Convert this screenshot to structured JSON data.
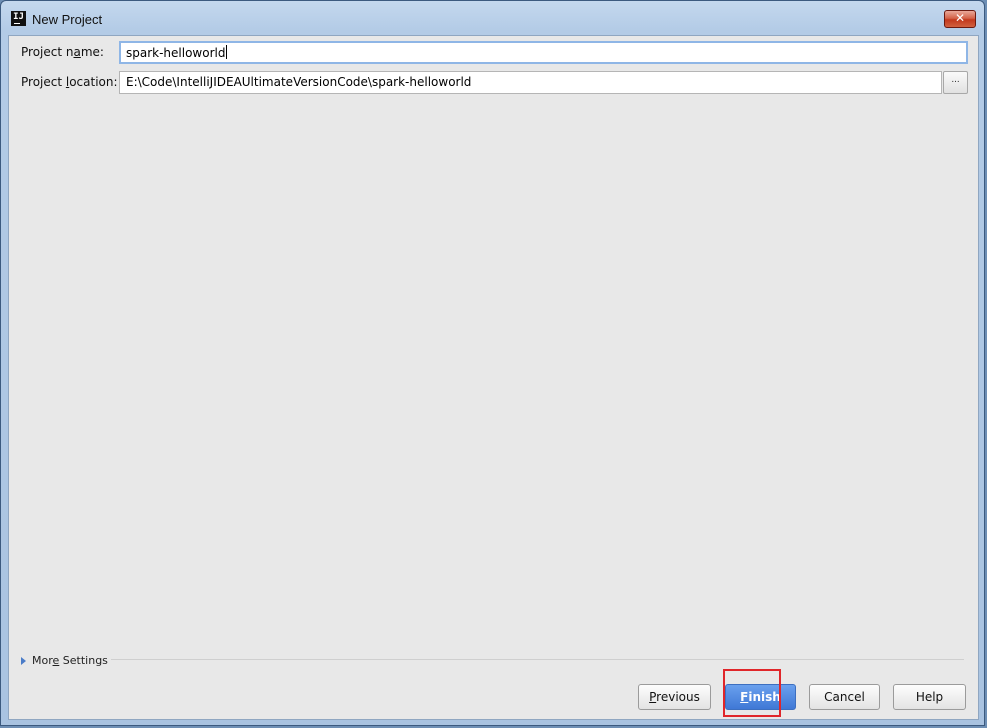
{
  "window": {
    "title": "New Project",
    "close_symbol": "✕",
    "app_icon_text": "IJ"
  },
  "form": {
    "project_name": {
      "label_pre": "Project n",
      "label_ul": "a",
      "label_post": "me:",
      "value": "spark-helloworld"
    },
    "project_location": {
      "label_pre": "Project ",
      "label_ul": "l",
      "label_post": "ocation:",
      "value": "E:\\Code\\IntelliJIDEAUltimateVersionCode\\spark-helloworld",
      "browse_label": "..."
    }
  },
  "more_settings": {
    "label_pre": "Mor",
    "label_ul": "e",
    "label_post": " Settings"
  },
  "buttons": {
    "previous": {
      "label_ul": "P",
      "label_post": "revious"
    },
    "finish": {
      "label_ul": "F",
      "label_post": "inish"
    },
    "cancel": {
      "label": "Cancel"
    },
    "help": {
      "label": "Help"
    }
  },
  "colors": {
    "accent": "#3f78d6",
    "highlight": "#e0262a",
    "panel": "#e8e8e8"
  }
}
